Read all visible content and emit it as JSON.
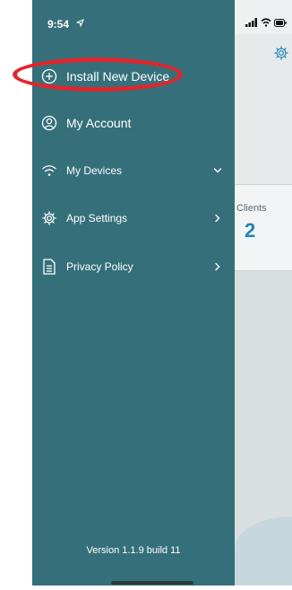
{
  "status_bar": {
    "time": "9:54"
  },
  "drawer": {
    "items": [
      {
        "label": "Install New Device",
        "icon": "plus-circle-icon"
      },
      {
        "label": "My Account",
        "icon": "user-circle-icon"
      },
      {
        "label": "My Devices",
        "icon": "wifi-icon",
        "chevron": "down"
      },
      {
        "label": "App Settings",
        "icon": "gear-icon",
        "chevron": "right"
      },
      {
        "label": "Privacy Policy",
        "icon": "document-icon",
        "chevron": "right"
      }
    ],
    "version": "Version 1.1.9 build 11"
  },
  "main": {
    "clients_label": "Clients",
    "clients_count": "2"
  },
  "colors": {
    "drawer_bg": "#35707a",
    "highlight": "#e0252c",
    "accent_number": "#1e86b4"
  }
}
